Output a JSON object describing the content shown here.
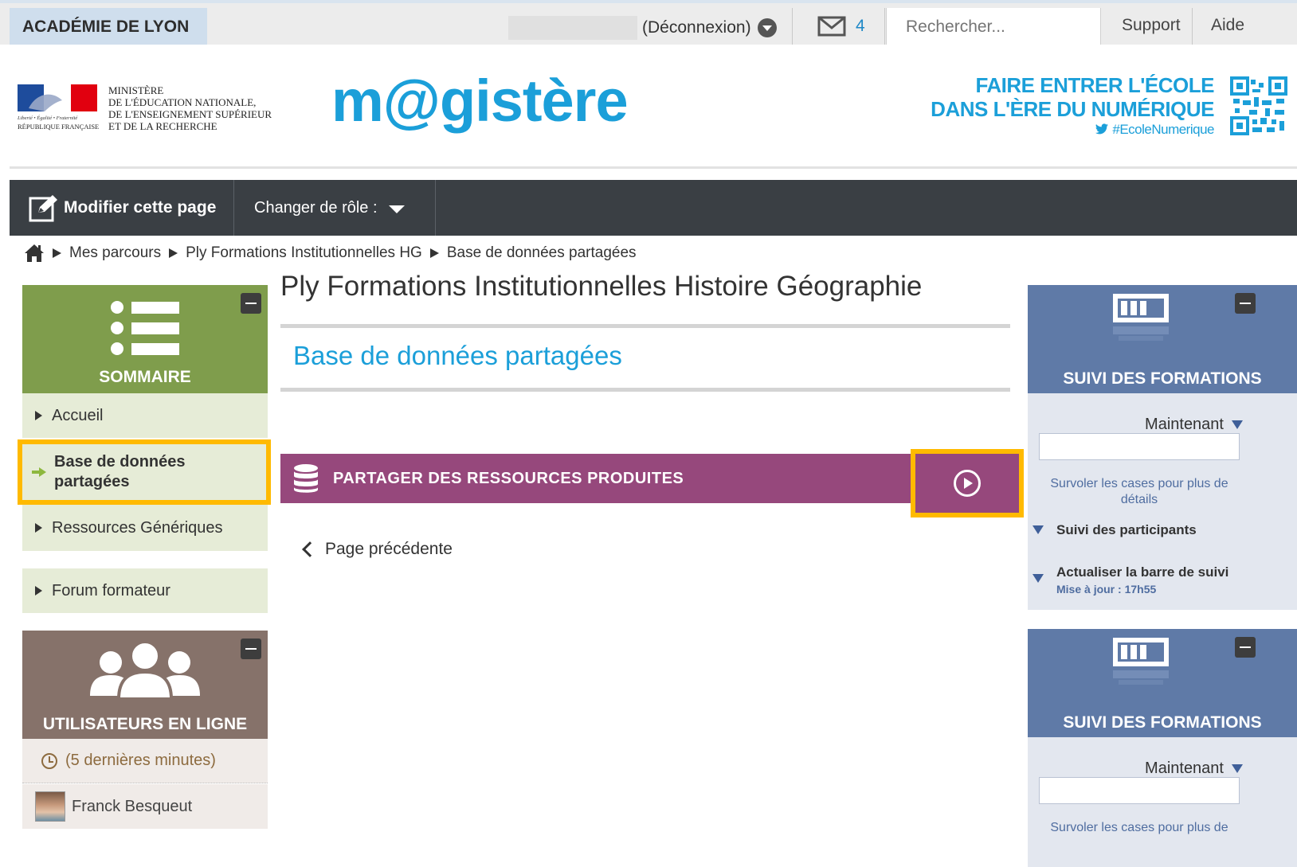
{
  "topbar": {
    "academie": "ACADÉMIE DE LYON",
    "logout_label": "(Déconnexion)",
    "mail_count": "4",
    "search_placeholder": "Rechercher...",
    "support_label": "Support",
    "aide_label": "Aide"
  },
  "header": {
    "ministry_lines": [
      "MINISTÈRE",
      "DE L'ÉDUCATION NATIONALE,",
      "DE L'ENSEIGNEMENT SUPÉRIEUR",
      "ET DE LA RECHERCHE"
    ],
    "republique": "RÉPUBLIQUE FRANÇAISE",
    "logo": "m@gistère",
    "slogan_line1": "FAIRE ENTRER L'ÉCOLE",
    "slogan_line2": "DANS L'ÈRE DU NUMÉRIQUE",
    "hashtag": "#EcoleNumerique"
  },
  "toolbar": {
    "edit_label": "Modifier cette page",
    "role_label": "Changer de rôle :"
  },
  "breadcrumb": {
    "items": [
      "Mes parcours",
      "Ply Formations Institutionnelles HG",
      "Base de données partagées"
    ]
  },
  "sommaire": {
    "title": "SOMMAIRE",
    "items": [
      {
        "label": "Accueil"
      },
      {
        "label": "Base de données partagées"
      },
      {
        "label": "Ressources Génériques"
      },
      {
        "label": "Forum formateur"
      }
    ]
  },
  "users_online": {
    "title": "UTILISATEURS EN LIGNE",
    "period": "(5 dernières minutes)",
    "users": [
      {
        "name": "Franck Besqueut"
      }
    ]
  },
  "main": {
    "course_title": "Ply Formations Institutionnelles Histoire Géographie",
    "section_title": "Base de données partagées",
    "banner_label": "PARTAGER DES RESSOURCES PRODUITES",
    "prev_label": "Page précédente"
  },
  "suivi": [
    {
      "title": "SUIVI DES FORMATIONS",
      "period": "Maintenant",
      "hint": "Survoler les cases pour plus de détails",
      "links": [
        {
          "label": "Suivi des participants"
        },
        {
          "label": "Actualiser la barre de suivi",
          "sub": "Mise à jour : 17h55"
        }
      ]
    },
    {
      "title": "SUIVI DES FORMATIONS",
      "period": "Maintenant",
      "hint": "Survoler les cases pour plus de"
    }
  ],
  "colors": {
    "brand_blue": "#1b9fd9",
    "toolbar_dark": "#3a3f44",
    "sommaire_green": "#7f9d4c",
    "banner_purple": "#96487c",
    "highlight_yellow": "#ffba00",
    "suivi_blue": "#5f7aa7",
    "users_brown": "#86726a"
  }
}
